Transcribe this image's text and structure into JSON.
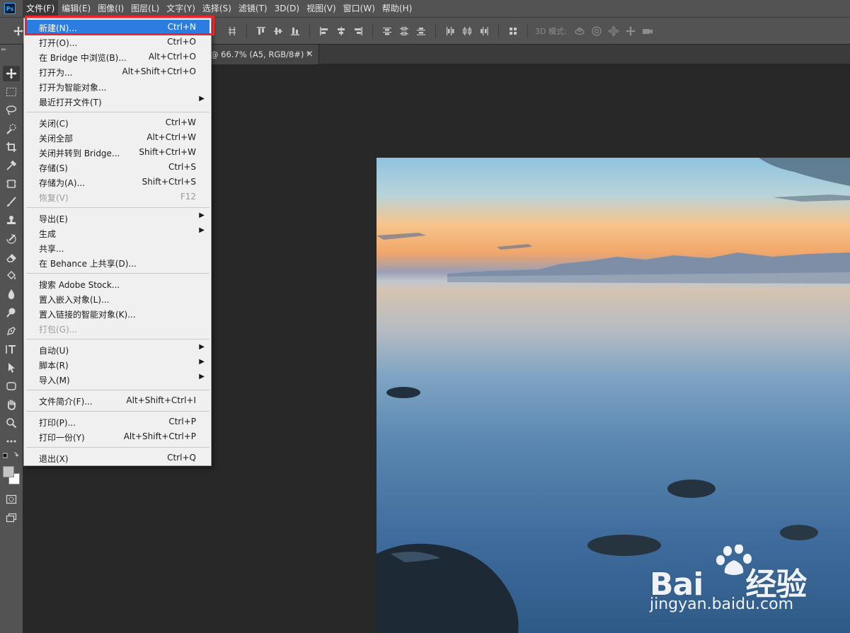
{
  "app": {
    "logo": "Ps"
  },
  "menubar": {
    "items": [
      "文件(F)",
      "编辑(E)",
      "图像(I)",
      "图层(L)",
      "文字(Y)",
      "选择(S)",
      "滤镜(T)",
      "3D(D)",
      "视图(V)",
      "窗口(W)",
      "帮助(H)"
    ],
    "active_index": 0
  },
  "options": {
    "mode_3d_label": "3D 模式:"
  },
  "document": {
    "tab_title": "@ 66.7% (A5, RGB/8#) *",
    "close_glyph": "×"
  },
  "file_menu": {
    "items": [
      {
        "label": "新建(N)...",
        "shortcut": "Ctrl+N",
        "highlight": true
      },
      {
        "label": "打开(O)...",
        "shortcut": "Ctrl+O"
      },
      {
        "label": "在 Bridge 中浏览(B)...",
        "shortcut": "Alt+Ctrl+O"
      },
      {
        "label": "打开为...",
        "shortcut": "Alt+Shift+Ctrl+O"
      },
      {
        "label": "打开为智能对象...",
        "shortcut": ""
      },
      {
        "label": "最近打开文件(T)",
        "shortcut": "",
        "submenu": true
      },
      {
        "label": "关闭(C)",
        "shortcut": "Ctrl+W"
      },
      {
        "label": "关闭全部",
        "shortcut": "Alt+Ctrl+W"
      },
      {
        "label": "关闭并转到 Bridge...",
        "shortcut": "Shift+Ctrl+W"
      },
      {
        "label": "存储(S)",
        "shortcut": "Ctrl+S"
      },
      {
        "label": "存储为(A)...",
        "shortcut": "Shift+Ctrl+S"
      },
      {
        "label": "恢复(V)",
        "shortcut": "F12",
        "disabled": true
      },
      {
        "label": "导出(E)",
        "shortcut": "",
        "submenu": true
      },
      {
        "label": "生成",
        "shortcut": "",
        "submenu": true
      },
      {
        "label": "共享...",
        "shortcut": ""
      },
      {
        "label": "在 Behance 上共享(D)...",
        "shortcut": ""
      },
      {
        "label": "搜索 Adobe Stock...",
        "shortcut": ""
      },
      {
        "label": "置入嵌入对象(L)...",
        "shortcut": ""
      },
      {
        "label": "置入链接的智能对象(K)...",
        "shortcut": ""
      },
      {
        "label": "打包(G)...",
        "shortcut": "",
        "disabled": true
      },
      {
        "label": "自动(U)",
        "shortcut": "",
        "submenu": true
      },
      {
        "label": "脚本(R)",
        "shortcut": "",
        "submenu": true
      },
      {
        "label": "导入(M)",
        "shortcut": "",
        "submenu": true
      },
      {
        "label": "文件简介(F)...",
        "shortcut": "Alt+Shift+Ctrl+I"
      },
      {
        "label": "打印(P)...",
        "shortcut": "Ctrl+P"
      },
      {
        "label": "打印一份(Y)",
        "shortcut": "Alt+Shift+Ctrl+P"
      },
      {
        "label": "退出(X)",
        "shortcut": "Ctrl+Q"
      }
    ],
    "submenu_arrow": "▶"
  },
  "watermark": {
    "brand": "Bai",
    "brand_cn": "经验",
    "url": "jingyan.baidu.com"
  },
  "colors": {
    "highlight_blue": "#2b7de1",
    "annotation_red": "#e8262b",
    "ps_blue": "#31a8ff"
  }
}
